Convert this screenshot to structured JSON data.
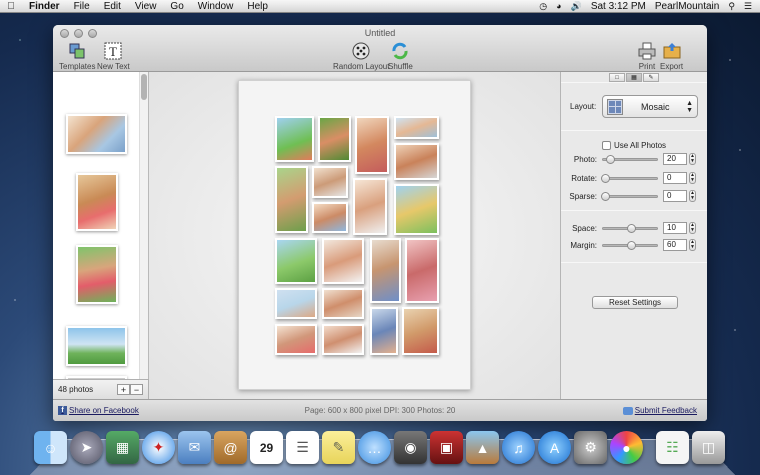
{
  "menubar": {
    "app": "Finder",
    "items": [
      "File",
      "Edit",
      "View",
      "Go",
      "Window",
      "Help"
    ],
    "clock": "Sat 3:12 PM",
    "user": "PearlMountain"
  },
  "window": {
    "title": "Untitled",
    "toolbar": {
      "templates": "Templates",
      "new_text": "New Text",
      "random_layout": "Random Layout",
      "shuffle": "Shuffle",
      "print": "Print",
      "export": "Export"
    }
  },
  "sidebar": {
    "photo_count": "48 photos",
    "add": "+",
    "remove": "−"
  },
  "panel": {
    "layout_label": "Layout:",
    "layout_value": "Mosaic",
    "use_all_photos": "Use All Photos",
    "photo_label": "Photo:",
    "photo_value": "20",
    "photo_level": 0.1,
    "rotate_label": "Rotate:",
    "rotate_value": "0",
    "rotate_level": 0.0,
    "sparse_label": "Sparse:",
    "sparse_value": "0",
    "sparse_level": 0.0,
    "space_label": "Space:",
    "space_value": "10",
    "space_level": 0.55,
    "margin_label": "Margin:",
    "margin_value": "60",
    "margin_level": 0.55,
    "reset_button": "Reset Settings"
  },
  "statusbar": {
    "share": "Share on Facebook",
    "info": "Page: 600 x 800 pixel DPI: 300 Photos: 20",
    "feedback": "Submit Feedback"
  },
  "colors": {
    "facebook": "#3b5998",
    "desktop": "#1f3a66"
  }
}
